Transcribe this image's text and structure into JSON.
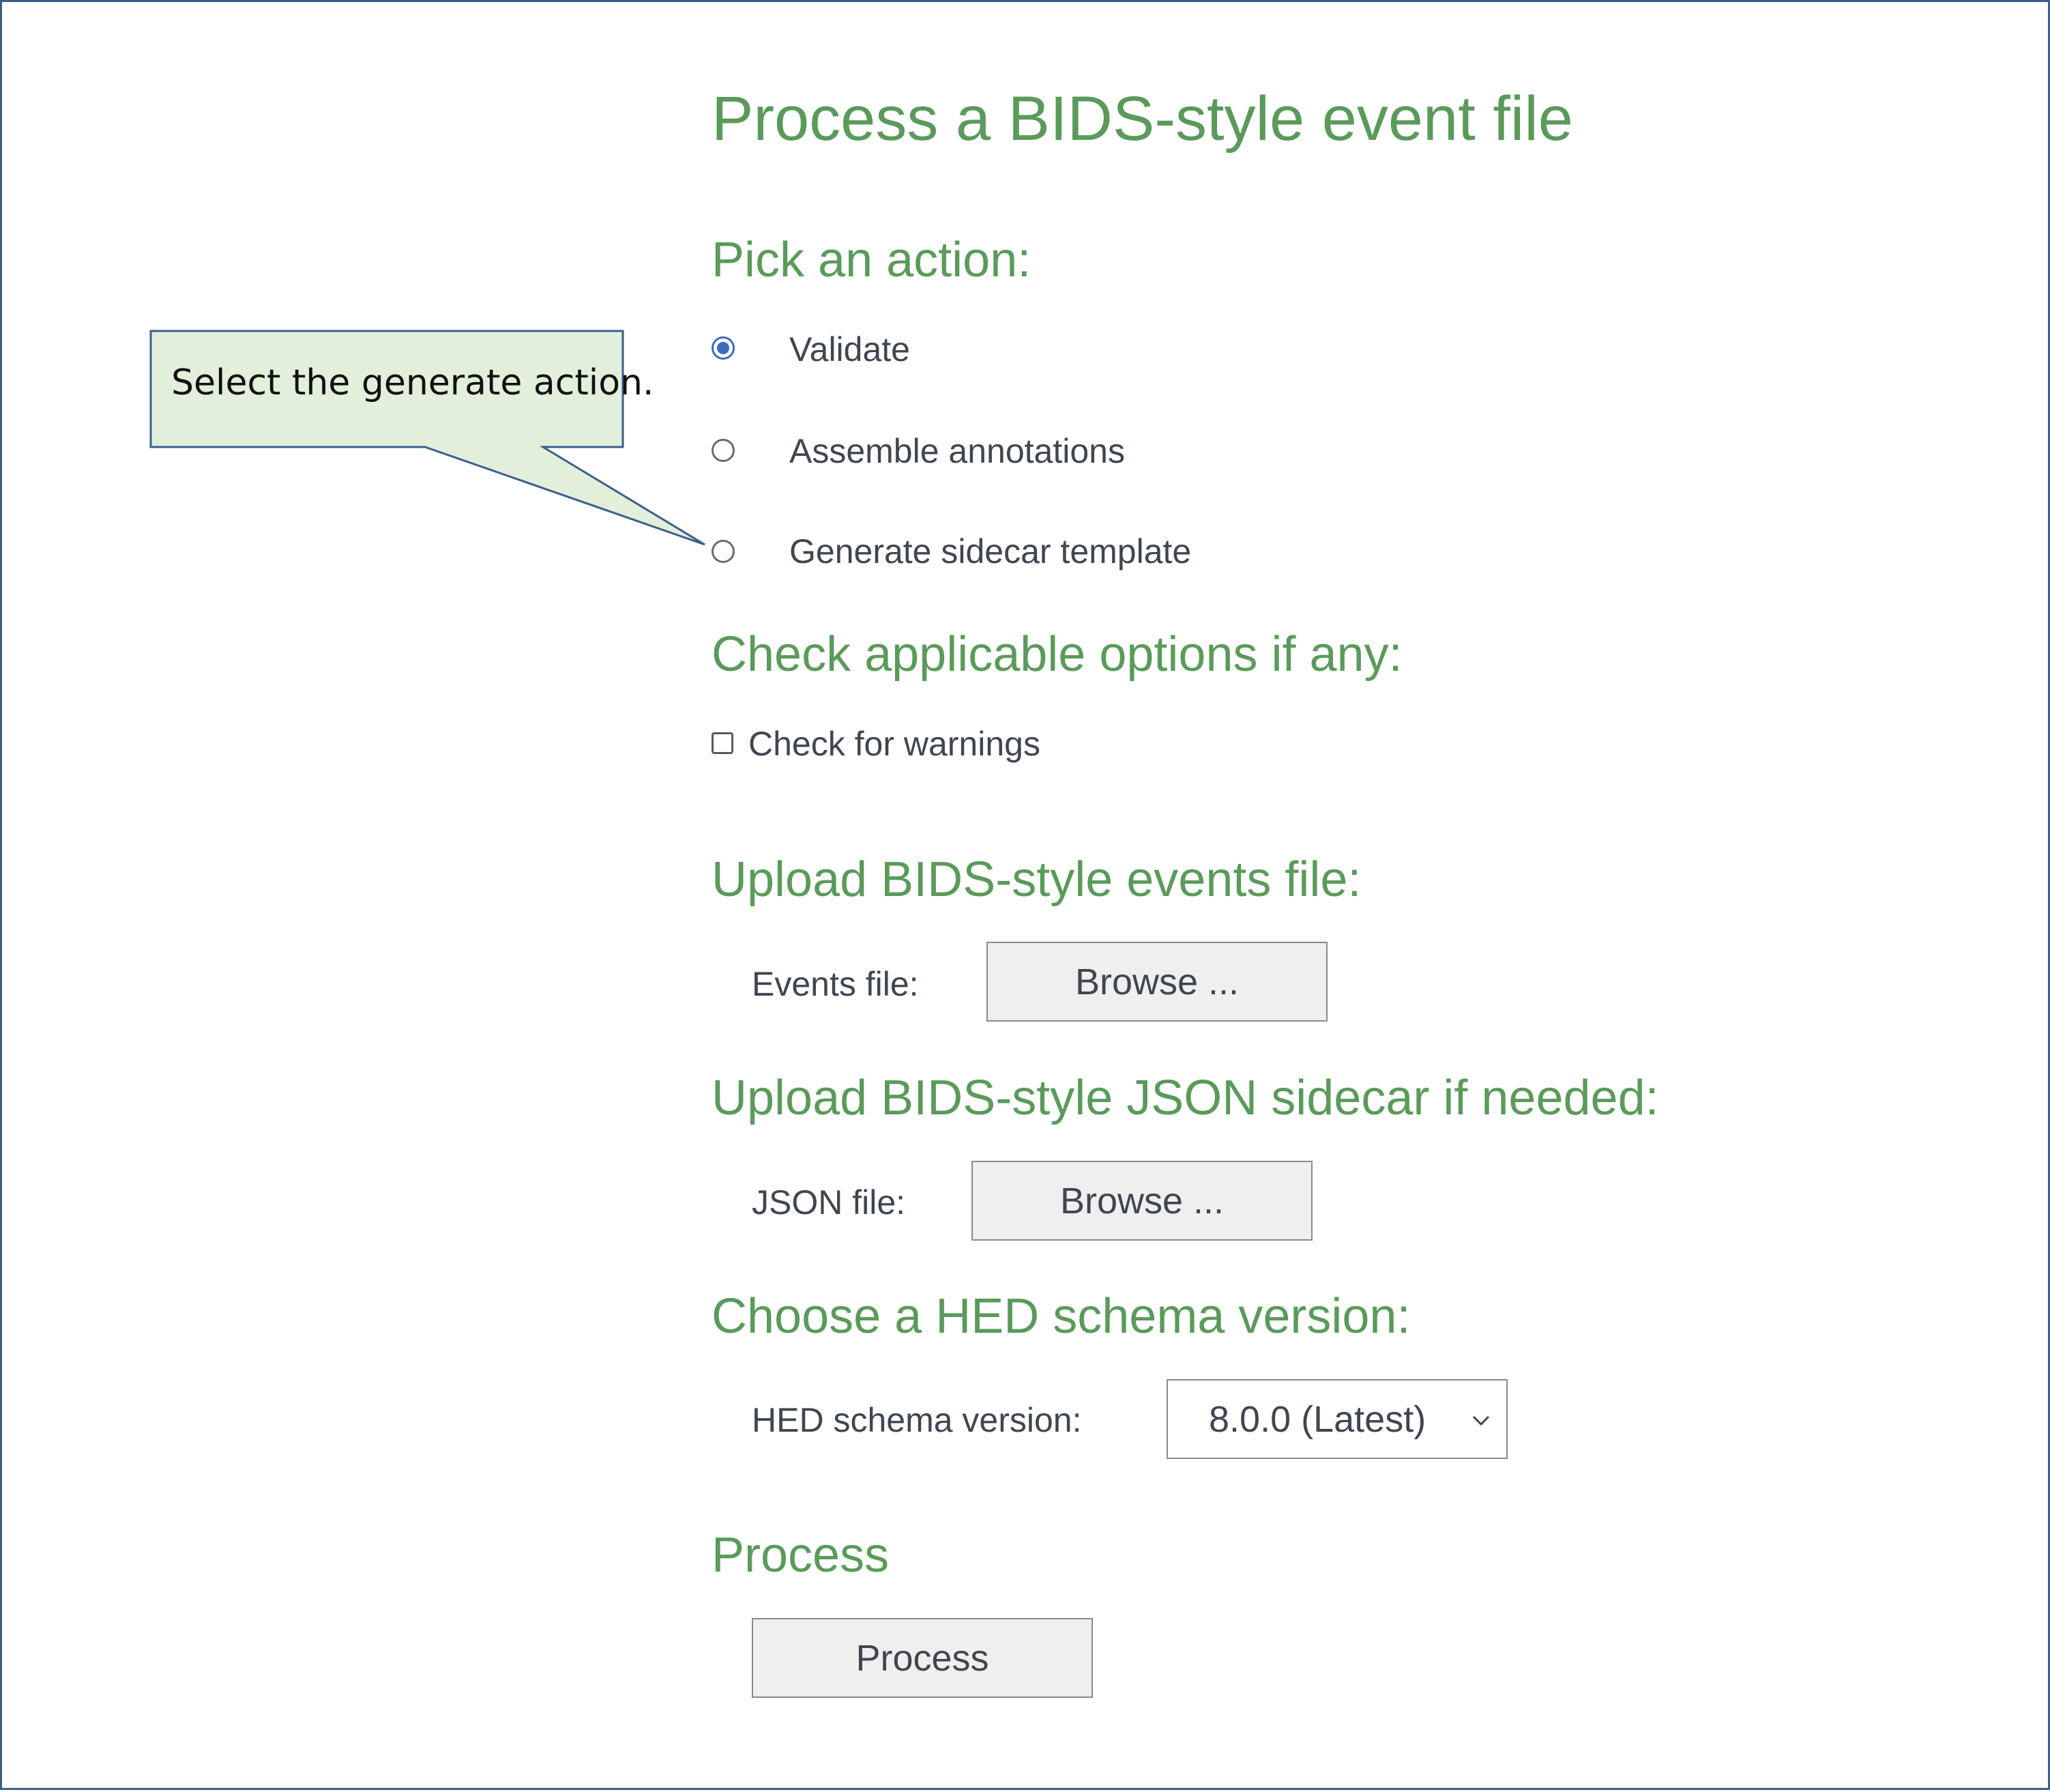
{
  "page": {
    "title": "Process a BIDS-style event file"
  },
  "actions": {
    "heading": "Pick an action:",
    "options": [
      {
        "label": "Validate",
        "selected": true
      },
      {
        "label": "Assemble annotations",
        "selected": false
      },
      {
        "label": "Generate sidecar template",
        "selected": false
      }
    ]
  },
  "options": {
    "heading": "Check applicable options if any:",
    "check_warnings": {
      "label": "Check for warnings",
      "checked": false
    }
  },
  "events_upload": {
    "heading": "Upload BIDS-style events file:",
    "label": "Events file:",
    "button": "Browse ..."
  },
  "json_upload": {
    "heading": "Upload BIDS-style JSON sidecar if needed:",
    "label": "JSON file:",
    "button": "Browse ..."
  },
  "schema": {
    "heading": "Choose a HED schema version:",
    "label": "HED schema version:",
    "selected": "8.0.0 (Latest)"
  },
  "process": {
    "heading": "Process",
    "button": "Process"
  },
  "callout": {
    "text": "Select the generate action."
  },
  "colors": {
    "heading_green": "#5a9a5a",
    "radio_blue": "#3d6bbf",
    "callout_fill": "#e2efda",
    "callout_border": "#3b5f8c",
    "frame_border": "#3b5f8c"
  }
}
